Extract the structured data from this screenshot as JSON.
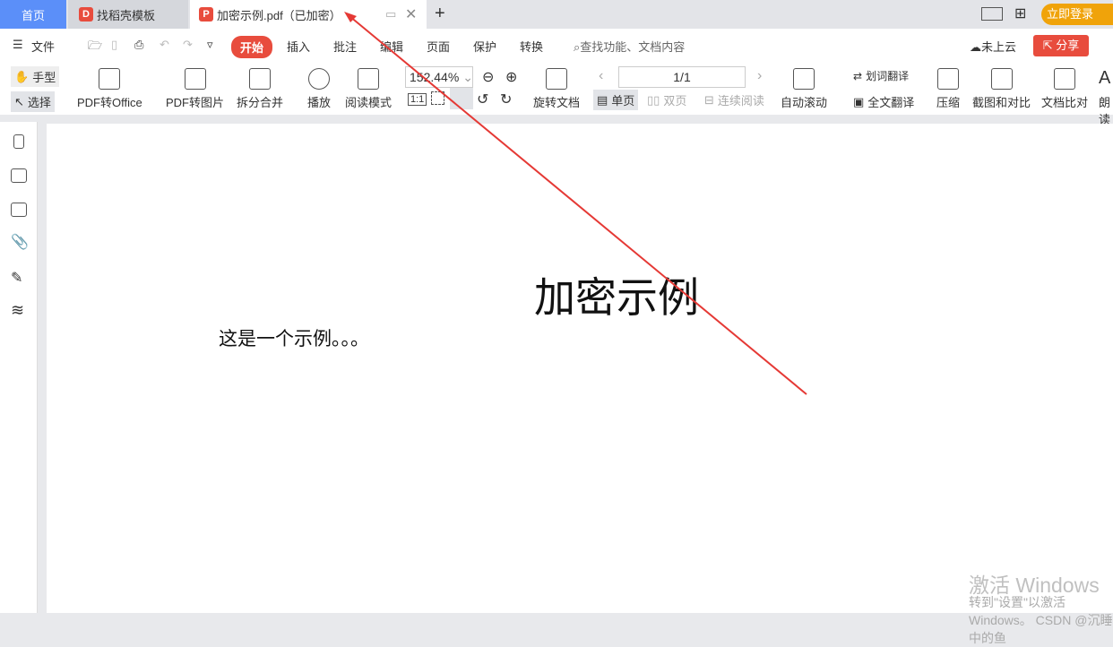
{
  "tabs": [
    {
      "label": "首页"
    },
    {
      "label": "找稻壳模板"
    },
    {
      "label": "加密示例.pdf（已加密）"
    }
  ],
  "tabbar": {
    "new_tab": "+",
    "login": "立即登录"
  },
  "menu": {
    "file": "文件",
    "items": [
      "开始",
      "插入",
      "批注",
      "编辑",
      "页面",
      "保护",
      "转换"
    ],
    "search_placeholder": "查找功能、文档内容",
    "cloud": "未上云",
    "share": "分享"
  },
  "ribbon": {
    "hand": "手型",
    "select": "选择",
    "pdf_to_office": "PDF转Office",
    "pdf_to_image": "PDF转图片",
    "split_merge": "拆分合并",
    "play": "播放",
    "read_mode": "阅读模式",
    "zoom": "152.44%",
    "rotate": "旋转文档",
    "page": "1/1",
    "single": "单页",
    "double": "双页",
    "continuous": "连续阅读",
    "auto_scroll": "自动滚动",
    "word_translate": "划词翻译",
    "full_translate": "全文翻译",
    "compress": "压缩",
    "screenshot_compare": "截图和对比",
    "doc_compare": "文档比对",
    "read_aloud": "朗读"
  },
  "document": {
    "title": "加密示例",
    "body": "这是一个示例。。。"
  },
  "watermark": {
    "line1": "激活 Windows",
    "line2": "转到\"设置\"以激活 Windows。  CSDN @沉睡中的鱼"
  },
  "colors": {
    "accent": "#e84c3d",
    "home_tab": "#5b8ff9",
    "login": "#f0a30a",
    "arrow": "#e53935"
  }
}
